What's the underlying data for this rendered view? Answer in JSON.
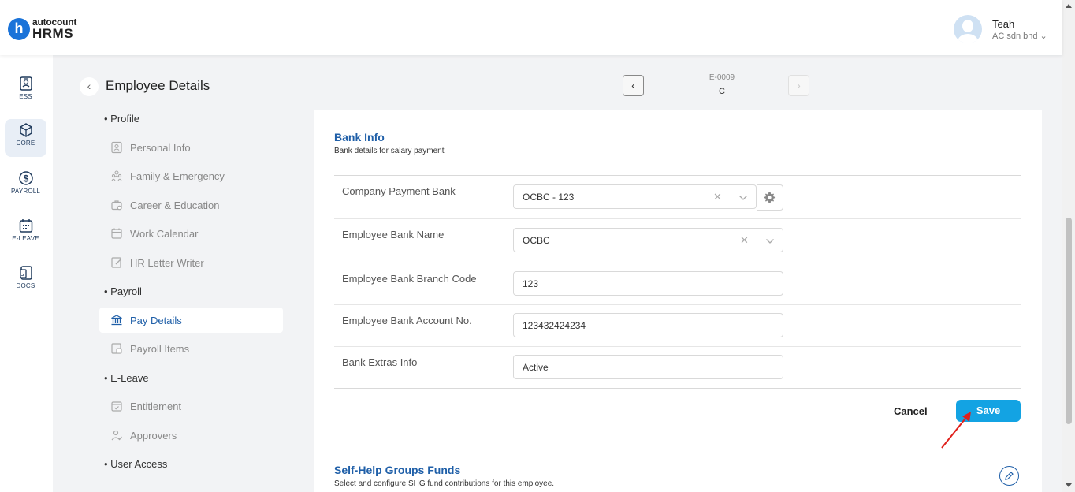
{
  "header": {
    "logo_letter": "h",
    "logo_brand": "autocount",
    "logo_product": "HRMS",
    "user_name": "Teah",
    "user_company": "AC sdn bhd"
  },
  "rail": [
    {
      "label": "ESS",
      "icon": "ess-icon"
    },
    {
      "label": "CORE",
      "icon": "core-icon",
      "active": true
    },
    {
      "label": "PAYROLL",
      "icon": "payroll-icon"
    },
    {
      "label": "E-LEAVE",
      "icon": "calendar-icon"
    },
    {
      "label": "DOCS",
      "icon": "docs-icon"
    }
  ],
  "page": {
    "title": "Employee Details",
    "employee_code": "E-0009",
    "employee_name": "C"
  },
  "menu": {
    "sections": [
      "Profile",
      "Payroll",
      "E-Leave",
      "User Access"
    ],
    "items": [
      {
        "label": "Personal Info",
        "icon": "id-card-icon"
      },
      {
        "label": "Family & Emergency",
        "icon": "family-icon"
      },
      {
        "label": "Career & Education",
        "icon": "career-icon"
      },
      {
        "label": "Work Calendar",
        "icon": "calendar-icon"
      },
      {
        "label": "HR Letter Writer",
        "icon": "letter-icon"
      },
      {
        "label": "Pay Details",
        "icon": "bank-icon",
        "active": true
      },
      {
        "label": "Payroll Items",
        "icon": "payroll-items-icon"
      },
      {
        "label": "Entitlement",
        "icon": "entitlement-icon"
      },
      {
        "label": "Approvers",
        "icon": "approvers-icon"
      }
    ]
  },
  "bank_info": {
    "title": "Bank Info",
    "subtitle": "Bank details for salary payment",
    "rows": [
      {
        "label": "Company Payment Bank",
        "value": "OCBC - 123"
      },
      {
        "label": "Employee Bank Name",
        "value": "OCBC"
      },
      {
        "label": "Employee Bank Branch Code",
        "value": "123"
      },
      {
        "label": "Employee Bank Account No.",
        "value": "123432424234"
      },
      {
        "label": "Bank Extras Info",
        "value": "Active"
      }
    ],
    "cancel_label": "Cancel",
    "save_label": "Save"
  },
  "shg": {
    "title": "Self-Help Groups Funds",
    "subtitle": "Select and configure SHG fund contributions for this employee."
  },
  "colors": {
    "accent": "#1f5fa8",
    "save_button": "#13a3e3",
    "annotation_arrow": "#e0201b"
  }
}
